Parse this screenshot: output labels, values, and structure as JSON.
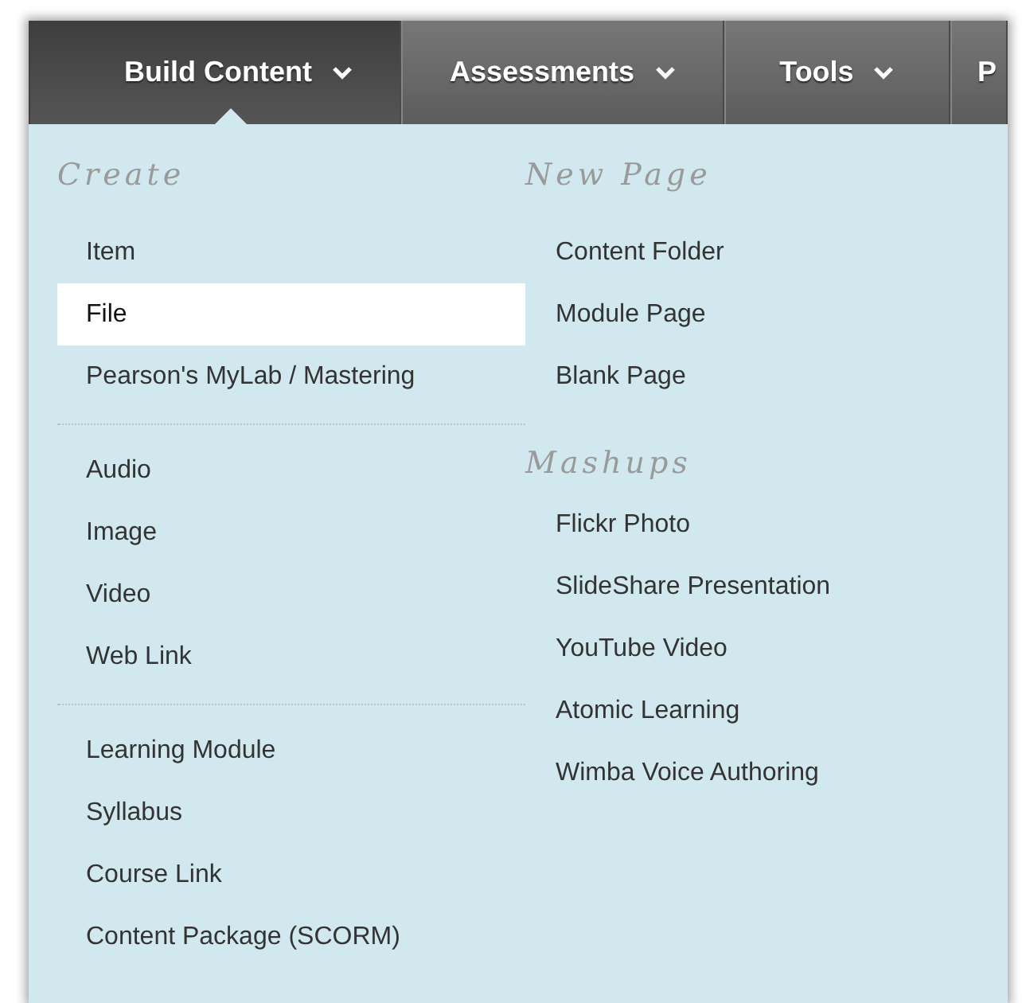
{
  "nav": {
    "tabs": [
      {
        "label": "Build Content",
        "selected": true,
        "has_menu": true
      },
      {
        "label": "Assessments",
        "selected": false,
        "has_menu": true
      },
      {
        "label": "Tools",
        "selected": false,
        "has_menu": true
      },
      {
        "label": "P",
        "selected": false,
        "has_menu": false
      }
    ]
  },
  "menu": {
    "columns": [
      {
        "sections": [
          {
            "heading": "Create",
            "divider_above": false,
            "items": [
              {
                "label": "Item",
                "selected": false
              },
              {
                "label": "File",
                "selected": true
              },
              {
                "label": "Pearson's MyLab / Mastering",
                "selected": false
              }
            ]
          },
          {
            "divider_above": true,
            "items": [
              {
                "label": "Audio",
                "selected": false
              },
              {
                "label": "Image",
                "selected": false
              },
              {
                "label": "Video",
                "selected": false
              },
              {
                "label": "Web Link",
                "selected": false
              }
            ]
          },
          {
            "divider_above": true,
            "items": [
              {
                "label": "Learning Module",
                "selected": false
              },
              {
                "label": "Syllabus",
                "selected": false
              },
              {
                "label": "Course Link",
                "selected": false
              },
              {
                "label": "Content Package (SCORM)",
                "selected": false
              }
            ]
          }
        ]
      },
      {
        "sections": [
          {
            "heading": "New Page",
            "divider_above": false,
            "items": [
              {
                "label": "Content Folder",
                "selected": false
              },
              {
                "label": "Module Page",
                "selected": false
              },
              {
                "label": "Blank Page",
                "selected": false
              }
            ]
          },
          {
            "heading": "Mashups",
            "divider_above": false,
            "items": [
              {
                "label": "Flickr Photo",
                "selected": false
              },
              {
                "label": "SlideShare Presentation",
                "selected": false
              },
              {
                "label": "YouTube Video",
                "selected": false
              },
              {
                "label": "Atomic Learning",
                "selected": false
              },
              {
                "label": "Wimba Voice Authoring",
                "selected": false
              }
            ]
          }
        ]
      }
    ]
  }
}
